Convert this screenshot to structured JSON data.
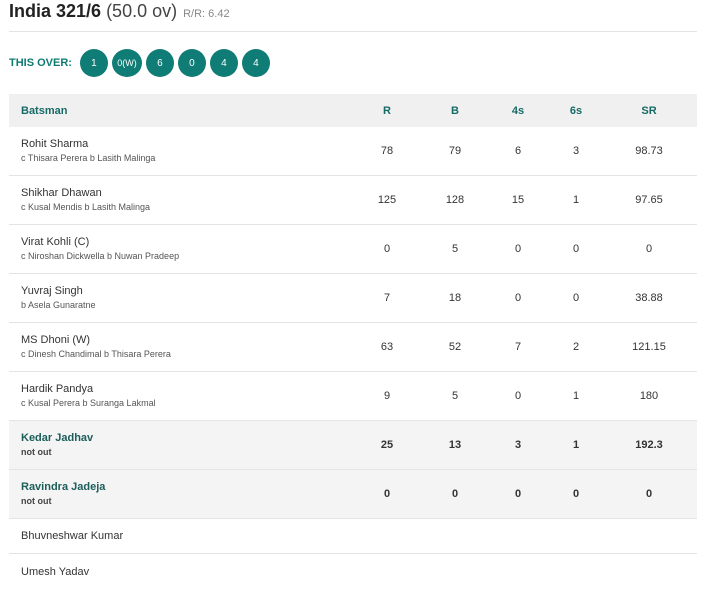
{
  "header": {
    "team_score": "India 321/6",
    "overs": "(50.0 ov)",
    "run_rate": "R/R: 6.42"
  },
  "this_over": {
    "label": "THIS OVER:",
    "balls": [
      "1",
      "0(W)",
      "6",
      "0",
      "4",
      "4"
    ]
  },
  "table": {
    "headers": {
      "batsman": "Batsman",
      "runs": "R",
      "balls": "B",
      "fours": "4s",
      "sixes": "6s",
      "strike_rate": "SR"
    },
    "batsmen": [
      {
        "name": "Rohit Sharma",
        "dismissal": "c Thisara Perera b Lasith Malinga",
        "r": "78",
        "b": "79",
        "fours": "6",
        "sixes": "3",
        "sr": "98.73"
      },
      {
        "name": "Shikhar Dhawan",
        "dismissal": "c Kusal Mendis b Lasith Malinga",
        "r": "125",
        "b": "128",
        "fours": "15",
        "sixes": "1",
        "sr": "97.65"
      },
      {
        "name": "Virat Kohli (C)",
        "dismissal": "c Niroshan Dickwella b Nuwan Pradeep",
        "r": "0",
        "b": "5",
        "fours": "0",
        "sixes": "0",
        "sr": "0"
      },
      {
        "name": "Yuvraj Singh",
        "dismissal": "b Asela Gunaratne",
        "r": "7",
        "b": "18",
        "fours": "0",
        "sixes": "0",
        "sr": "38.88"
      },
      {
        "name": "MS Dhoni (W)",
        "dismissal": "c Dinesh Chandimal b Thisara Perera",
        "r": "63",
        "b": "52",
        "fours": "7",
        "sixes": "2",
        "sr": "121.15"
      },
      {
        "name": "Hardik Pandya",
        "dismissal": "c Kusal Perera b Suranga Lakmal",
        "r": "9",
        "b": "5",
        "fours": "0",
        "sixes": "1",
        "sr": "180"
      },
      {
        "name": "Kedar Jadhav",
        "dismissal": "not out",
        "r": "25",
        "b": "13",
        "fours": "3",
        "sixes": "1",
        "sr": "192.3"
      },
      {
        "name": "Ravindra Jadeja",
        "dismissal": "not out",
        "r": "0",
        "b": "0",
        "fours": "0",
        "sixes": "0",
        "sr": "0"
      }
    ],
    "did_not_bat": [
      "Bhuvneshwar Kumar",
      "Umesh Yadav"
    ]
  },
  "colors": {
    "accent": "#0f7d75",
    "header_text": "#166a66",
    "header_bg": "#f0f0f0",
    "not_out_bg": "#f4f4f4"
  }
}
